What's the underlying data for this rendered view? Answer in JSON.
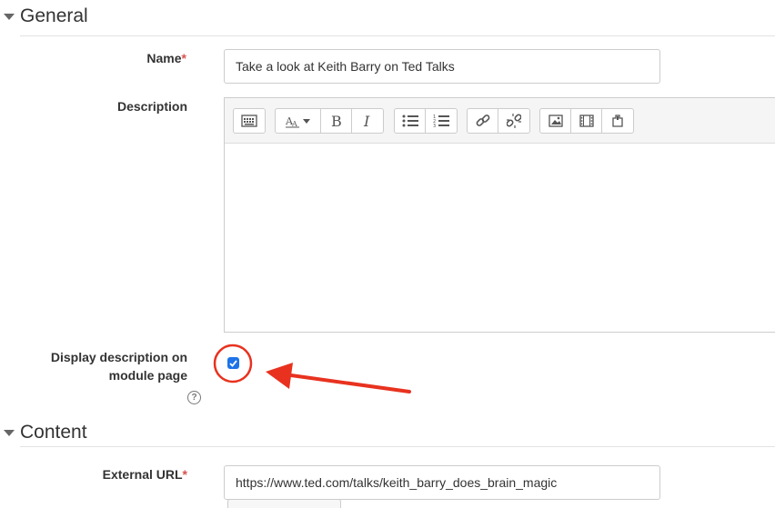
{
  "sections": {
    "general": {
      "title": "General"
    },
    "content": {
      "title": "Content"
    }
  },
  "fields": {
    "name": {
      "label": "Name",
      "required_mark": "*",
      "value": "Take a look at Keith Barry on Ted Talks"
    },
    "description": {
      "label": "Description"
    },
    "display_description": {
      "label_line1": "Display description on",
      "label_line2": "module page",
      "checked": true
    },
    "external_url": {
      "label": "External URL",
      "required_mark": "*",
      "value": "https://www.ted.com/talks/keith_barry_does_brain_magic"
    }
  },
  "editor_toolbar": {
    "icons": [
      "toolbar-toggle-icon",
      "font-style-icon",
      "bold-icon",
      "italic-icon",
      "unordered-list-icon",
      "ordered-list-icon",
      "link-icon",
      "unlink-icon",
      "image-icon",
      "media-icon",
      "manage-files-icon"
    ]
  },
  "colors": {
    "required": "#d9534f",
    "checkbox": "#1e73e8",
    "annotation": "#e8321f"
  }
}
